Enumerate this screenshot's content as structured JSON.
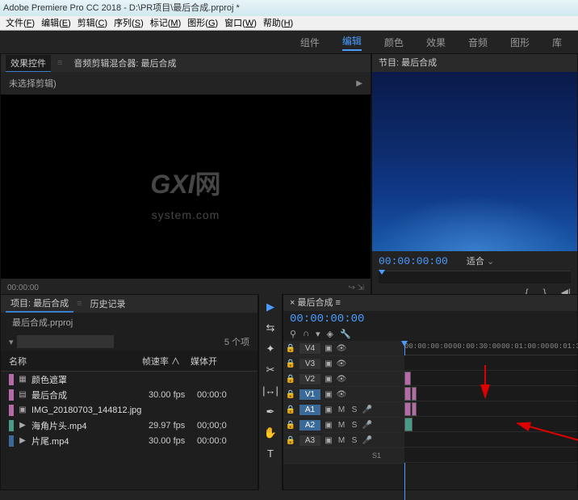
{
  "titlebar": "Adobe Premiere Pro CC 2018 - D:\\PR项目\\最后合成.prproj *",
  "menus": [
    "文件(F)",
    "编辑(E)",
    "剪辑(C)",
    "序列(S)",
    "标记(M)",
    "图形(G)",
    "窗口(W)",
    "帮助(H)"
  ],
  "workspace": {
    "items": [
      "组件",
      "编辑",
      "颜色",
      "效果",
      "音频",
      "图形",
      "库"
    ],
    "active": 1
  },
  "source": {
    "tab1": "效果控件",
    "tab2": "音频剪辑混合器: 最后合成",
    "noclip": "未选择剪辑)",
    "timecode": "00:00:00"
  },
  "program": {
    "title": "节目: 最后合成",
    "timecode": "00:00:00:00",
    "fit": "适合"
  },
  "watermark": {
    "big": "GXI",
    "suffix": "网",
    "sub": "system.com"
  },
  "project": {
    "tab1": "项目: 最后合成",
    "tab2": "历史记录",
    "name": "最后合成.prproj",
    "search_placeholder": "",
    "count": "5 个项",
    "cols": {
      "c1": "名称",
      "c2": "帧速率 ∧",
      "c3": "媒体开"
    },
    "items": [
      {
        "swatch": "#b76aa8",
        "icon": "fx",
        "name": "颜色遮罩",
        "fps": "",
        "start": ""
      },
      {
        "swatch": "#b76aa8",
        "icon": "seq",
        "name": "最后合成",
        "fps": "30.00 fps",
        "start": "00:00:0"
      },
      {
        "swatch": "#b76aa8",
        "icon": "img",
        "name": "IMG_20180703_144812.jpg",
        "fps": "",
        "start": ""
      },
      {
        "swatch": "#4a9a8a",
        "icon": "vid",
        "name": "海角片头.mp4",
        "fps": "29.97 fps",
        "start": "00;00;0"
      },
      {
        "swatch": "#3a6a9a",
        "icon": "vid",
        "name": "片尾.mp4",
        "fps": "30.00 fps",
        "start": "00:00:0"
      }
    ]
  },
  "timeline": {
    "title": "最后合成",
    "timecode": "00:00:00:00",
    "ticks": [
      "00:00:00:00",
      "00:00:30:00",
      "00:01:00:00",
      "00:01:30:00",
      "00:0"
    ],
    "video_tracks": [
      "V4",
      "V3",
      "V2",
      "V1"
    ],
    "audio_tracks": [
      "A1",
      "A2",
      "A3"
    ],
    "selected_v": "V1",
    "selected_a": [
      "A1",
      "A2"
    ]
  }
}
